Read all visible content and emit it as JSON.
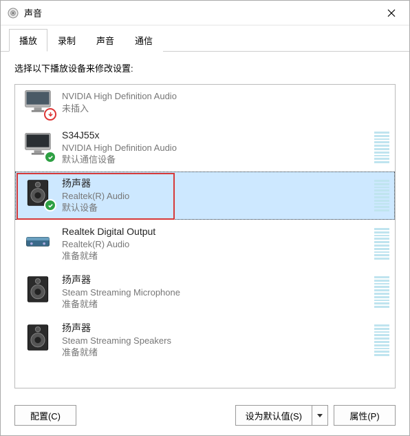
{
  "window": {
    "title": "声音"
  },
  "tabs": {
    "playback": "播放",
    "recording": "录制",
    "sounds": "声音",
    "communications": "通信"
  },
  "instruction": "选择以下播放设备来修改设置:",
  "devices": [
    {
      "name_visible": "",
      "subtitle": "NVIDIA High Definition Audio",
      "status": "未插入",
      "icon": "monitor",
      "badge": "unplugged",
      "meter": false,
      "cutoff": true
    },
    {
      "name": "S34J55x",
      "subtitle": "NVIDIA High Definition Audio",
      "status": "默认通信设备",
      "icon": "monitor",
      "badge": "green-check",
      "meter": true
    },
    {
      "name": "扬声器",
      "subtitle": "Realtek(R) Audio",
      "status": "默认设备",
      "icon": "speaker-dark",
      "badge": "green-check",
      "meter": true,
      "selected": true,
      "highlight": true
    },
    {
      "name": "Realtek Digital Output",
      "subtitle": "Realtek(R) Audio",
      "status": "准备就绪",
      "icon": "spdif",
      "badge": null,
      "meter": true
    },
    {
      "name": "扬声器",
      "subtitle": "Steam Streaming Microphone",
      "status": "准备就绪",
      "icon": "speaker-dark",
      "badge": null,
      "meter": true
    },
    {
      "name": "扬声器",
      "subtitle": "Steam Streaming Speakers",
      "status": "准备就绪",
      "icon": "speaker-dark",
      "badge": null,
      "meter": true
    }
  ],
  "buttons": {
    "configure": "配置(C)",
    "set_default": "设为默认值(S)",
    "properties": "属性(P)"
  }
}
